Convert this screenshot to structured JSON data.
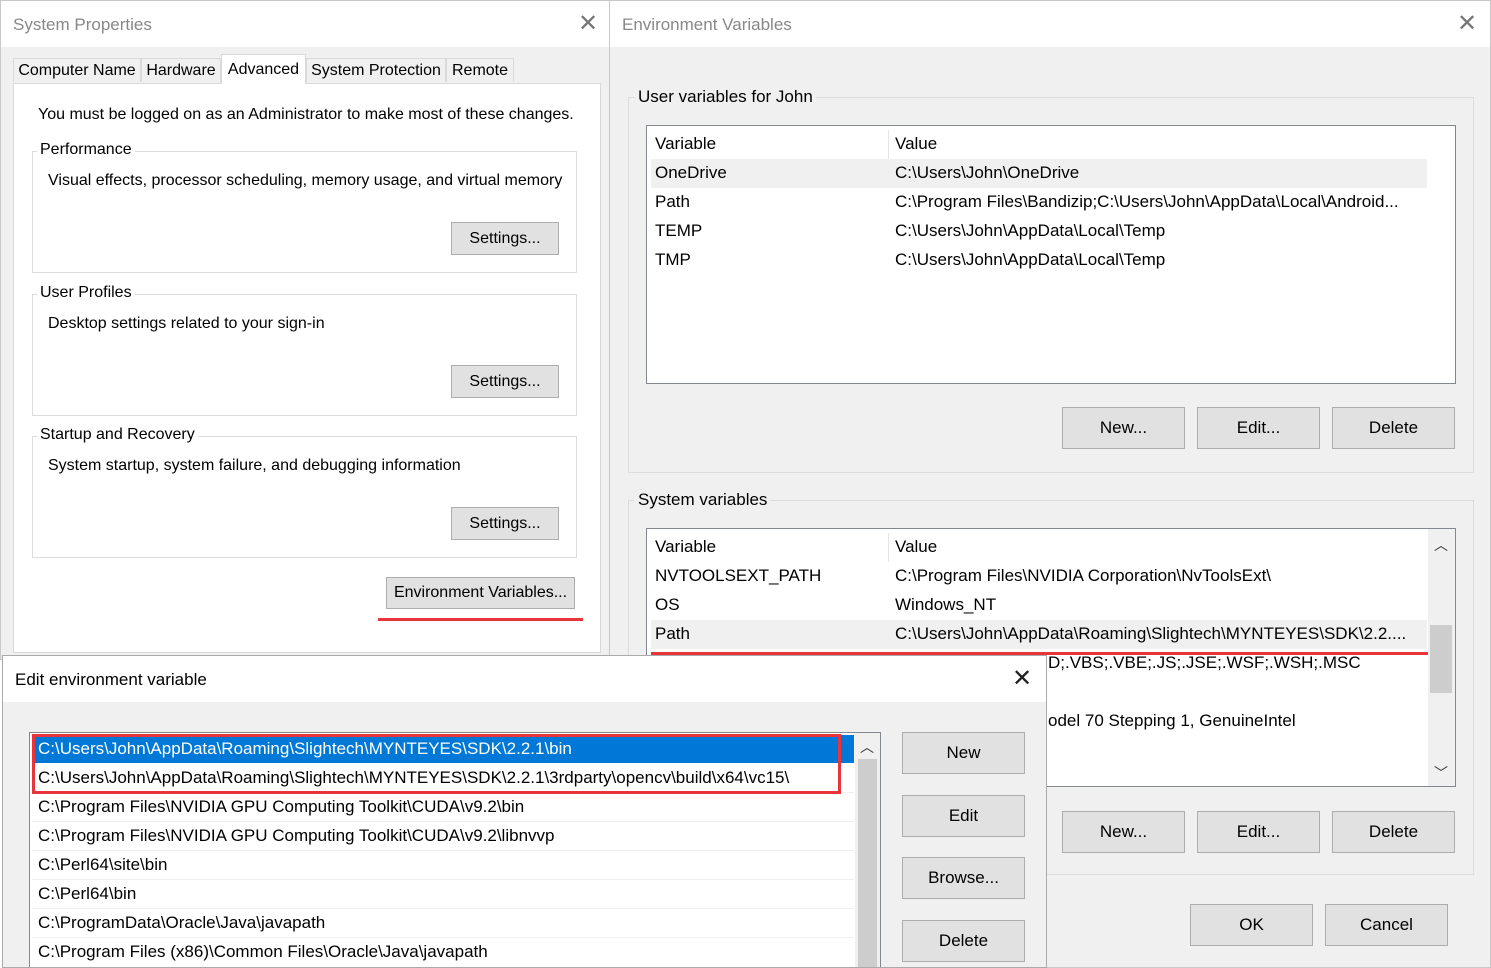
{
  "system_properties": {
    "title": "System Properties",
    "tabs": [
      {
        "label": "Computer Name"
      },
      {
        "label": "Hardware"
      },
      {
        "label": "Advanced"
      },
      {
        "label": "System Protection"
      },
      {
        "label": "Remote"
      }
    ],
    "admin_notice": "You must be logged on as an Administrator to make most of these changes.",
    "performance": {
      "label": "Performance",
      "description": "Visual effects, processor scheduling, memory usage, and virtual memory",
      "button": "Settings..."
    },
    "user_profiles": {
      "label": "User Profiles",
      "description": "Desktop settings related to your sign-in",
      "button": "Settings..."
    },
    "startup_recovery": {
      "label": "Startup and Recovery",
      "description": "System startup, system failure, and debugging information",
      "button": "Settings..."
    },
    "env_button": "Environment Variables..."
  },
  "environment_variables": {
    "title": "Environment Variables",
    "user_section_label": "User variables for John",
    "system_section_label": "System variables",
    "columns": {
      "variable": "Variable",
      "value": "Value"
    },
    "user_vars": [
      {
        "name": "OneDrive",
        "value": "C:\\Users\\John\\OneDrive"
      },
      {
        "name": "Path",
        "value": "C:\\Program Files\\Bandizip;C:\\Users\\John\\AppData\\Local\\Android..."
      },
      {
        "name": "TEMP",
        "value": "C:\\Users\\John\\AppData\\Local\\Temp"
      },
      {
        "name": "TMP",
        "value": "C:\\Users\\John\\AppData\\Local\\Temp"
      }
    ],
    "system_vars": [
      {
        "name": "NVTOOLSEXT_PATH",
        "value": "C:\\Program Files\\NVIDIA Corporation\\NvToolsExt\\"
      },
      {
        "name": "OS",
        "value": "Windows_NT"
      },
      {
        "name": "Path",
        "value": "C:\\Users\\John\\AppData\\Roaming\\Slightech\\MYNTEYES\\SDK\\2.2...."
      }
    ],
    "system_vars_partial": [
      {
        "value": "D;.VBS;.VBE;.JS;.JSE;.WSF;.WSH;.MSC"
      },
      {
        "value": "odel 70 Stepping 1, GenuineIntel"
      }
    ],
    "buttons": {
      "new": "New...",
      "edit": "Edit...",
      "delete": "Delete",
      "ok": "OK",
      "cancel": "Cancel"
    }
  },
  "edit_env": {
    "title": "Edit environment variable",
    "entries": [
      "C:\\Users\\John\\AppData\\Roaming\\Slightech\\MYNTEYES\\SDK\\2.2.1\\bin",
      "C:\\Users\\John\\AppData\\Roaming\\Slightech\\MYNTEYES\\SDK\\2.2.1\\3rdparty\\opencv\\build\\x64\\vc15\\",
      "C:\\Program Files\\NVIDIA GPU Computing Toolkit\\CUDA\\v9.2\\bin",
      "C:\\Program Files\\NVIDIA GPU Computing Toolkit\\CUDA\\v9.2\\libnvvp",
      "C:\\Perl64\\site\\bin",
      "C:\\Perl64\\bin",
      "C:\\ProgramData\\Oracle\\Java\\javapath",
      "C:\\Program Files (x86)\\Common Files\\Oracle\\Java\\javapath"
    ],
    "buttons": {
      "new": "New",
      "edit": "Edit",
      "browse": "Browse...",
      "delete": "Delete"
    }
  },
  "colors": {
    "selection": "#0078d7",
    "annotation": "#e8353b",
    "hover_row": "#f0f0f0"
  },
  "icons": [
    "close-icon",
    "scroll-up-icon",
    "scroll-down-icon"
  ]
}
